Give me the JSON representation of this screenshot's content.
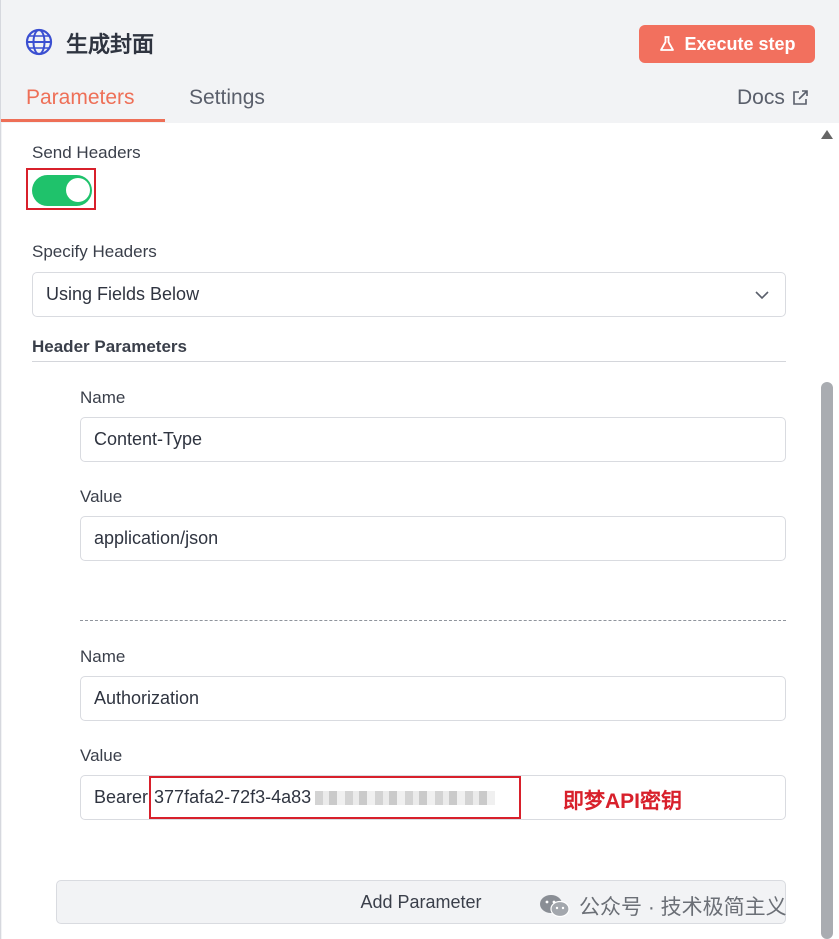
{
  "header": {
    "title": "生成封面",
    "execute_label": "Execute step",
    "tabs": [
      {
        "label": "Parameters",
        "active": true
      },
      {
        "label": "Settings",
        "active": false
      }
    ],
    "docs_label": "Docs"
  },
  "colors": {
    "accent": "#ee6f57",
    "execute_button": "#f2705e",
    "toggle_on": "#1fc26b",
    "annotation_red": "#d8202b"
  },
  "send_headers": {
    "label": "Send Headers",
    "enabled": true
  },
  "specify_headers": {
    "label": "Specify Headers",
    "value": "Using Fields Below"
  },
  "header_parameters": {
    "label": "Header Parameters",
    "items": [
      {
        "name_label": "Name",
        "name_value": "Content-Type",
        "value_label": "Value",
        "value_value": "application/json"
      },
      {
        "name_label": "Name",
        "name_value": "Authorization",
        "value_label": "Value",
        "value_prefix": "Bearer",
        "value_value": "377fafa2-72f3-4a83"
      }
    ]
  },
  "annotation": "即梦API密钥",
  "add_parameter_label": "Add Parameter",
  "watermark": "公众号 · 技术极简主义",
  "icons": [
    "globe-icon",
    "flask-icon",
    "external-link-icon",
    "chevron-down-icon",
    "wechat-icon"
  ]
}
